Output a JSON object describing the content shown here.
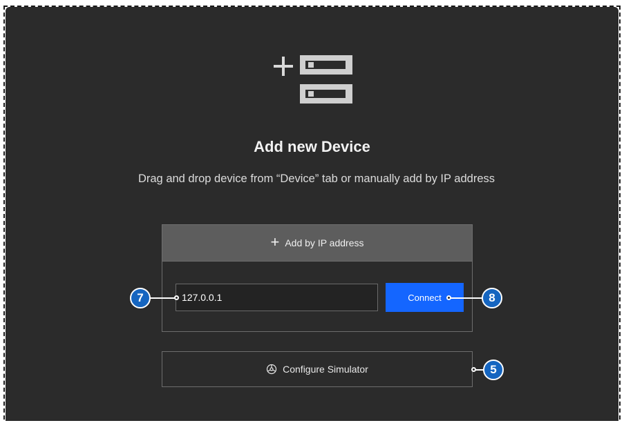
{
  "header": {
    "title": "Add new Device",
    "subtitle": "Drag and drop device from “Device” tab or manually add by IP address"
  },
  "add_by_ip": {
    "label": "Add by IP address",
    "ip_value": "127.0.0.1",
    "connect_label": "Connect"
  },
  "simulator": {
    "label": "Configure Simulator"
  },
  "callouts": {
    "ip_field": "7",
    "connect": "8",
    "simulator": "5"
  },
  "colors": {
    "panel_bg": "#2b2b2b",
    "header_bg": "#5d5d5d",
    "accent": "#1466ff",
    "callout": "#1565c0"
  },
  "icons": {
    "hero": "add-device-icon",
    "add": "plus-icon",
    "simulator": "simulator-icon"
  }
}
